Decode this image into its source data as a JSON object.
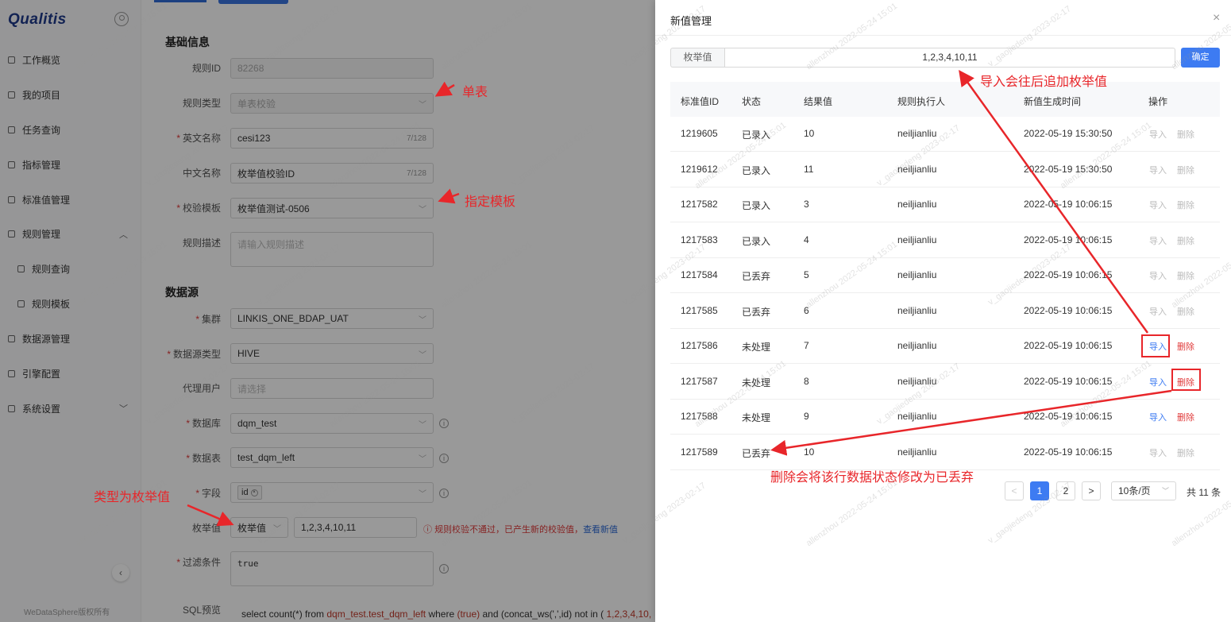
{
  "app": {
    "logo": "Qualitis",
    "copyright": "WeDataSphere版权所有"
  },
  "sidebar": {
    "items": [
      {
        "label": "工作概览"
      },
      {
        "label": "我的项目"
      },
      {
        "label": "任务查询"
      },
      {
        "label": "指标管理"
      },
      {
        "label": "标准值管理"
      },
      {
        "label": "规则管理",
        "expanded": true
      },
      {
        "label": "规则查询"
      },
      {
        "label": "规则模板"
      },
      {
        "label": "数据源管理"
      },
      {
        "label": "引擎配置"
      },
      {
        "label": "系统设置"
      }
    ]
  },
  "form": {
    "section_basic": "基础信息",
    "rule_id": {
      "label": "规则ID",
      "value": "82268"
    },
    "rule_type": {
      "label": "规则类型",
      "value": "单表校验"
    },
    "en_name": {
      "label": "英文名称",
      "value": "cesi123",
      "count": "7/128"
    },
    "cn_name": {
      "label": "中文名称",
      "value": "枚举值校验ID",
      "count": "7/128"
    },
    "template": {
      "label": "校验模板",
      "value": "枚举值测试-0506"
    },
    "desc": {
      "label": "规则描述",
      "placeholder": "请输入规则描述"
    },
    "section_source": "数据源",
    "cluster": {
      "label": "集群",
      "value": "LINKIS_ONE_BDAP_UAT"
    },
    "source_type": {
      "label": "数据源类型",
      "value": "HIVE"
    },
    "proxy_user": {
      "label": "代理用户",
      "placeholder": "请选择"
    },
    "database": {
      "label": "数据库",
      "value": "dqm_test"
    },
    "table": {
      "label": "数据表",
      "value": "test_dqm_left"
    },
    "field": {
      "label": "字段",
      "tag": "id"
    },
    "enum": {
      "label": "枚举值",
      "type": "枚举值",
      "value": "1,2,3,4,10,11"
    },
    "error": {
      "text": "规则校验不通过，已产生新的校验值，",
      "link": "查看新值"
    },
    "filter": {
      "label": "过滤条件",
      "value": "true"
    },
    "sql": {
      "label": "SQL预览",
      "p1": "select count(*) from ",
      "p2": "dqm_test.test_dqm_left",
      "p3": " where ",
      "p4": "(true)",
      "p5": " and (concat_ws(',',id) not in ( ",
      "p6": "1,2,3,4,10,"
    }
  },
  "drawer": {
    "title": "新值管理",
    "close": "×",
    "enum_label": "枚举值",
    "enum_value": "1,2,3,4,10,11",
    "confirm": "确定",
    "columns": [
      "标准值ID",
      "状态",
      "结果值",
      "规则执行人",
      "新值生成时间",
      "操作"
    ],
    "rows": [
      {
        "id": "1219605",
        "status": "已录入",
        "value": "10",
        "user": "neiljianliu",
        "time": "2022-05-19 15:30:50",
        "enabled": false
      },
      {
        "id": "1219612",
        "status": "已录入",
        "value": "11",
        "user": "neiljianliu",
        "time": "2022-05-19 15:30:50",
        "enabled": false
      },
      {
        "id": "1217582",
        "status": "已录入",
        "value": "3",
        "user": "neiljianliu",
        "time": "2022-05-19 10:06:15",
        "enabled": false
      },
      {
        "id": "1217583",
        "status": "已录入",
        "value": "4",
        "user": "neiljianliu",
        "time": "2022-05-19 10:06:15",
        "enabled": false
      },
      {
        "id": "1217584",
        "status": "已丢弃",
        "value": "5",
        "user": "neiljianliu",
        "time": "2022-05-19 10:06:15",
        "enabled": false
      },
      {
        "id": "1217585",
        "status": "已丢弃",
        "value": "6",
        "user": "neiljianliu",
        "time": "2022-05-19 10:06:15",
        "enabled": false
      },
      {
        "id": "1217586",
        "status": "未处理",
        "value": "7",
        "user": "neiljianliu",
        "time": "2022-05-19 10:06:15",
        "enabled": true
      },
      {
        "id": "1217587",
        "status": "未处理",
        "value": "8",
        "user": "neiljianliu",
        "time": "2022-05-19 10:06:15",
        "enabled": true
      },
      {
        "id": "1217588",
        "status": "未处理",
        "value": "9",
        "user": "neiljianliu",
        "time": "2022-05-19 10:06:15",
        "enabled": true
      },
      {
        "id": "1217589",
        "status": "已丢弃",
        "value": "10",
        "user": "neiljianliu",
        "time": "2022-05-19 10:06:15",
        "enabled": false
      }
    ],
    "actions": {
      "import": "导入",
      "delete": "删除"
    },
    "pagination": {
      "prev": "<",
      "pages": [
        "1",
        "2"
      ],
      "current": "1",
      "next": ">",
      "page_size": "10条/页",
      "total": "共 11 条"
    }
  },
  "annotations": {
    "single_table": "单表",
    "template": "指定模板",
    "enum_type": "类型为枚举值",
    "import_note": "导入会往后追加枚举值",
    "delete_note": "删除会将该行数据状态修改为已丢弃"
  },
  "watermark": {
    "user": "allenzhou",
    "date": "2022-05-24 15:01",
    "account": "v_gaojiedeng",
    "date2": "2023-02-17"
  },
  "colors": {
    "accent": "#3d7bf2",
    "danger": "#e03a3a",
    "annotation": "#e8262a",
    "mask": "rgba(0,0,0,0.4)"
  }
}
